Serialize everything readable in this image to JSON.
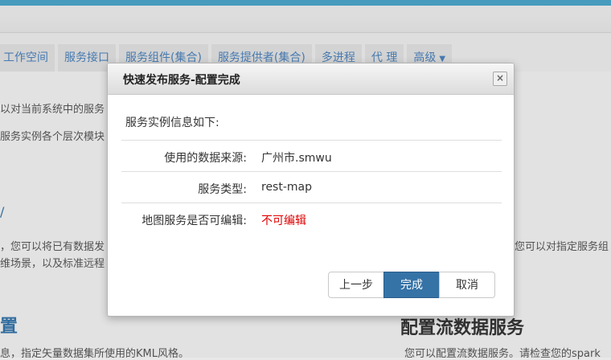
{
  "tabs": [
    {
      "label": "工作空间"
    },
    {
      "label": "服务接口"
    },
    {
      "label": "服务组件(集合)"
    },
    {
      "label": "服务提供者(集合)"
    },
    {
      "label": "多进程"
    },
    {
      "label": "代 理"
    },
    {
      "label": "高级"
    }
  ],
  "background": {
    "line1": "以对当前系统中的服务",
    "line2": "服务实例各个层次模块",
    "mark": "/",
    "line3": "，您可以将已有数据发",
    "line4": "维场景，以及标准远程",
    "heading_left": "置",
    "footer_left": "息，指定矢量数据集所使用的KML风格。",
    "right_line": "您可以对指定服务组",
    "heading_right": "配置流数据服务",
    "footer_right": "您可以配置流数据服务。请检查您的spark"
  },
  "dialog": {
    "title": "快速发布服务-配置完成",
    "close_icon": "×",
    "intro": "服务实例信息如下:",
    "rows": [
      {
        "label": "使用的数据来源:",
        "value": "广州市.smwu"
      },
      {
        "label": "服务类型:",
        "value": "rest-map"
      },
      {
        "label": "地图服务是否可编辑:",
        "value": "不可编辑"
      }
    ],
    "buttons": {
      "prev": "上一步",
      "finish": "完成",
      "cancel": "取消"
    }
  },
  "colors": {
    "accent": "#3572a6",
    "warning": "#e00000",
    "topbar": "#4aa3c5"
  }
}
